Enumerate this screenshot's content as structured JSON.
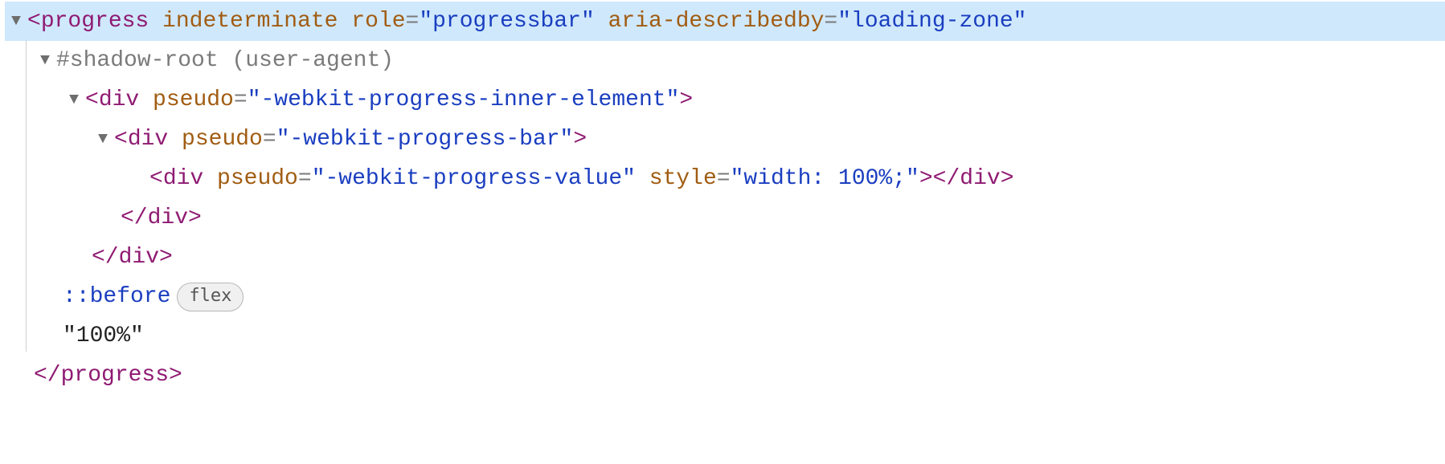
{
  "line1": {
    "tag": "progress",
    "attr1": "indeterminate",
    "attr2": "role",
    "val2": "\"progressbar\"",
    "attr3": "aria-describedby",
    "val3": "\"loading-zone\""
  },
  "line2": {
    "text": "#shadow-root (user-agent)"
  },
  "line3": {
    "tag": "div",
    "attr": "pseudo",
    "val": "\"-webkit-progress-inner-element\""
  },
  "line4": {
    "tag": "div",
    "attr": "pseudo",
    "val": "\"-webkit-progress-bar\""
  },
  "line5": {
    "tag": "div",
    "attr1": "pseudo",
    "val1": "\"-webkit-progress-value\"",
    "attr2": "style",
    "val2": "\"width: 100%;\"",
    "closetag": "div"
  },
  "line6": {
    "closetag": "div"
  },
  "line7": {
    "closetag": "div"
  },
  "line8": {
    "pseudo": "::before",
    "badge": "flex"
  },
  "line9": {
    "text": "\"100%\""
  },
  "line10": {
    "closetag": "progress"
  },
  "punct": {
    "lt": "<",
    "gt": ">",
    "slash": "/",
    "eq": "=",
    "ltslash": "</",
    "gtlt": "><",
    "space": " "
  }
}
